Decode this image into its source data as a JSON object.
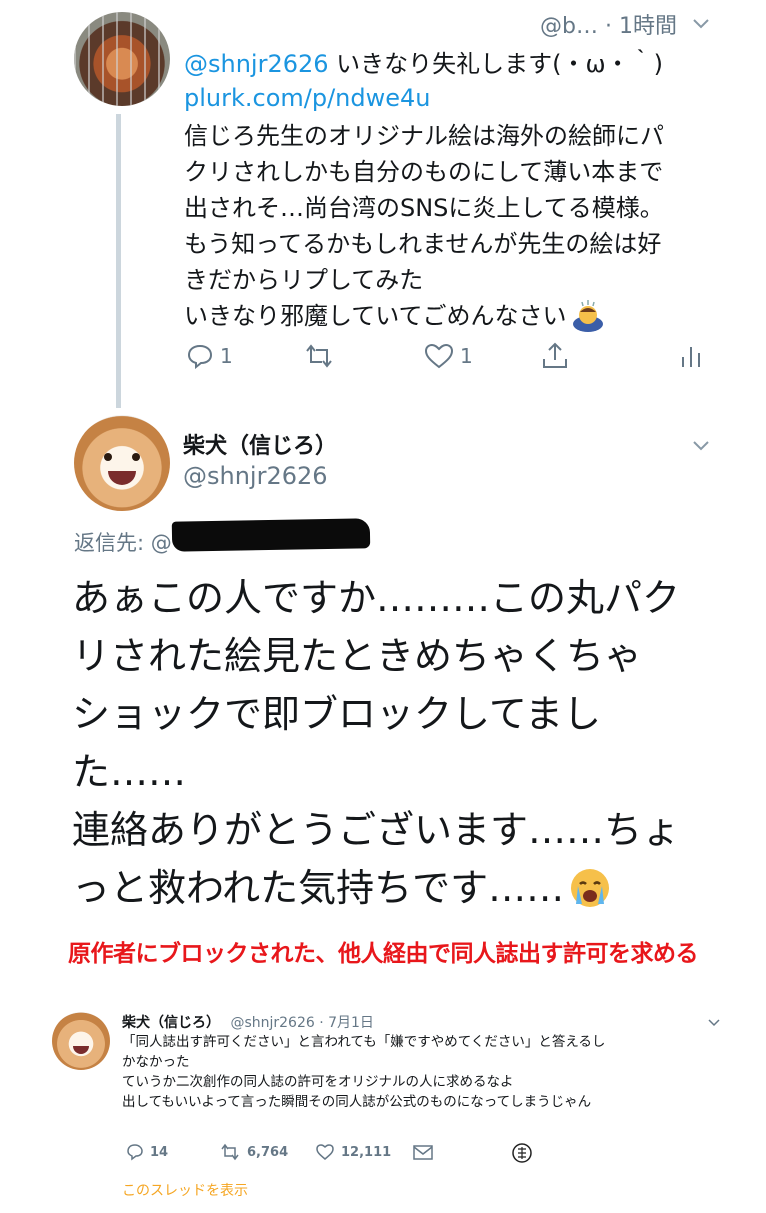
{
  "tweet1": {
    "meta": "@b… · 1時間",
    "mention": "@shnjr2626",
    "first_line_rest": " いきなり失礼します(・ω・｀)",
    "link": "plurk.com/p/ndwe4u",
    "lines": [
      "信じろ先生のオリジナル絵は海外の絵師にパ",
      "クリされしかも自分のものにして薄い本まで",
      "出されそ…尚台湾のSNSに炎上してる模様。",
      "もう知ってるかもしれませんが先生の絵は好",
      "きだからリプしてみた",
      "いきなり邪魔していてごめんなさい"
    ],
    "reply_count": "1",
    "like_count": "1"
  },
  "tweet2": {
    "name": "柴犬（信じろ）",
    "handle": "@shnjr2626",
    "reply_to_label": "返信先: @",
    "lines": [
      "あぁこの人ですか………この丸パク",
      "リされた絵見たときめちゃくちゃ",
      "ショックで即ブロックしてまし",
      "た……",
      "連絡ありがとうございます……ちょ",
      "っと救われた気持ちです……"
    ]
  },
  "caption": "原作者にブロックされた、他人経由で同人誌出す許可を求める",
  "tweet3": {
    "name": "柴犬（信じろ）",
    "handle_date": "@shnjr2626 · 7月1日",
    "lines": [
      "「同人誌出す許可ください」と言われても「嫌ですやめてください」と答えるし",
      "かなかった",
      "ていうか二次創作の同人誌の許可をオリジナルの人に求めるなよ",
      "出してもいいよって言った瞬間その同人誌が公式のものになってしまうじゃん"
    ],
    "reply_count": "14",
    "retweet_count": "6,764",
    "like_count": "12,111",
    "thread_link": "このスレッドを表示"
  },
  "colors": {
    "link": "#1b95e0",
    "muted": "#657786",
    "caption_red": "#e8171b",
    "thread_link": "#f5a623"
  }
}
